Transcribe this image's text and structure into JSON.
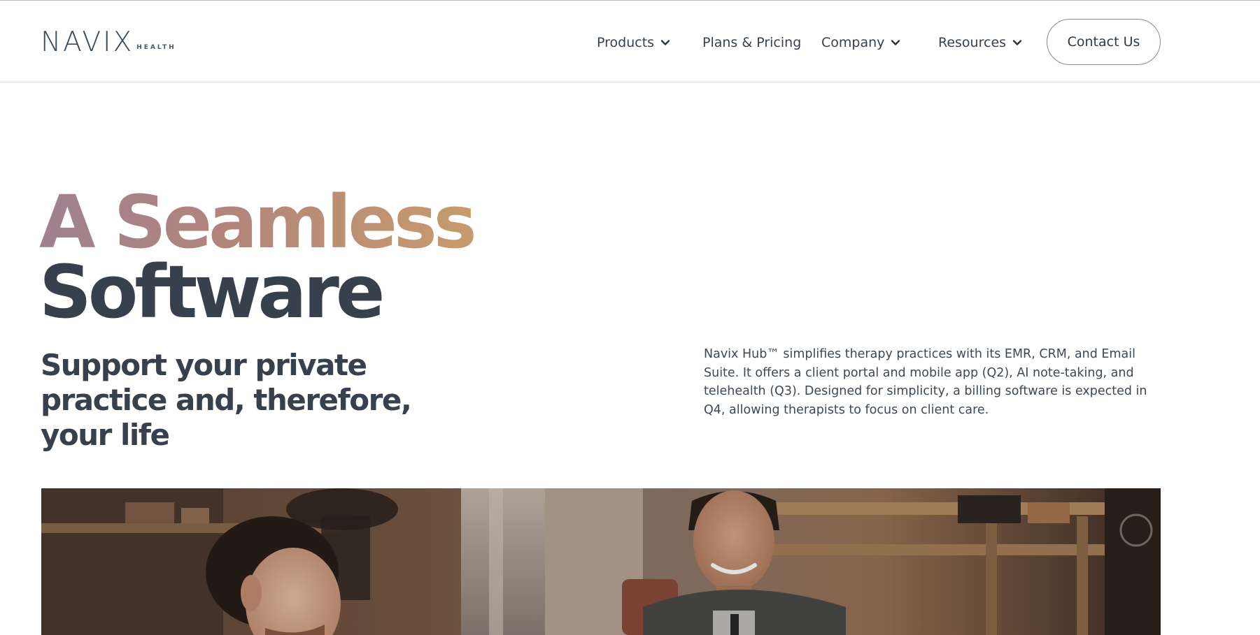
{
  "brand": {
    "logo_text": "NAVIX",
    "logo_sub": "HEALTH"
  },
  "nav": {
    "items": [
      {
        "label": "Products",
        "has_dropdown": true
      },
      {
        "label": "Plans & Pricing",
        "has_dropdown": false
      },
      {
        "label": "Company",
        "has_dropdown": true
      },
      {
        "label": "Resources",
        "has_dropdown": true
      }
    ],
    "contact_label": "Contact Us"
  },
  "hero": {
    "title_line1": "A Seamless",
    "title_line2": "Software",
    "subhead": "Support your private practice and, therefore, your life",
    "description": "Navix Hub™ simplifies therapy practices with its EMR, CRM, and Email Suite. It offers a client portal and mobile app (Q2), AI note-taking, and telehealth (Q3). Designed for simplicity, a billing software is expected in Q4, allowing therapists to focus on client care."
  },
  "colors": {
    "text_dark": "#36414d",
    "gradient_start": "#9e8190",
    "gradient_end": "#c79b6c",
    "button_border": "#9b8289"
  }
}
